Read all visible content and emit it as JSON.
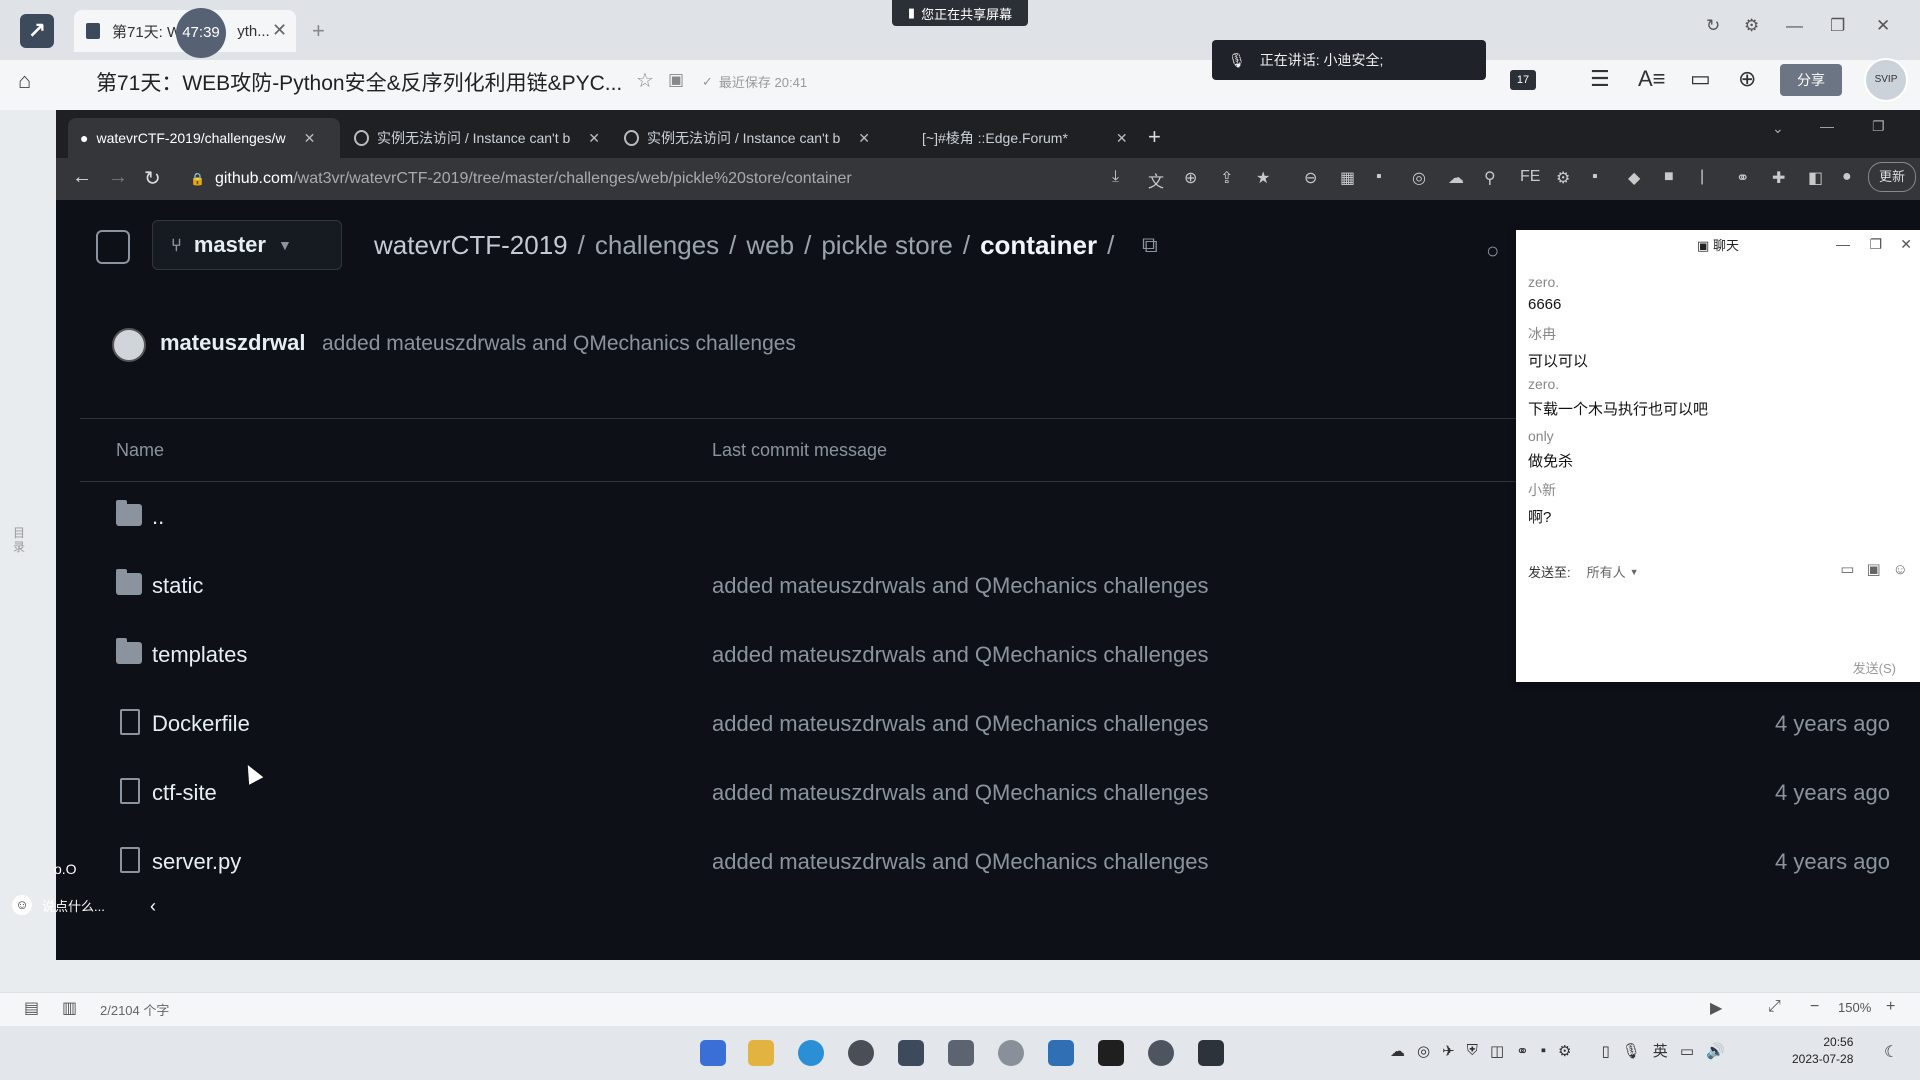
{
  "app": {
    "tab_title": "第71天: W",
    "tab_title_suffix": "yth...",
    "timer": "47:39",
    "sharing_banner": "您正在共享屏幕",
    "doc_title": "第71天：WEB攻防-Python安全&反序列化利用链&PYC...",
    "save_status": "最近保存 20:41",
    "speaking": "正在讲话: 小迪安全;",
    "count_badge": "17",
    "share_label": "分享",
    "avatar_label": "SVIP",
    "left_rail": "目录"
  },
  "browser": {
    "tabs": [
      {
        "label": "watevrCTF-2019/challenges/w"
      },
      {
        "label": "实例无法访问 / Instance can't b"
      },
      {
        "label": "实例无法访问 / Instance can't b"
      },
      {
        "label": "[~]#棱角 ::Edge.Forum*"
      }
    ],
    "url_host": "github.com",
    "url_path": "/wat3vr/watevrCTF-2019/tree/master/challenges/web/pickle%20store/container",
    "update_label": "更新"
  },
  "github": {
    "branch": "master",
    "breadcrumb": {
      "repo": "watevrCTF-2019",
      "parts": [
        "challenges",
        "web",
        "pickle store"
      ],
      "current": "container"
    },
    "commit": {
      "author": "mateuszdrwal",
      "message": "added mateuszdrwals and QMechanics challenges"
    },
    "table": {
      "col_name": "Name",
      "col_message": "Last commit message",
      "rows": [
        {
          "type": "folder",
          "name": "..",
          "message": "",
          "date": ""
        },
        {
          "type": "folder",
          "name": "static",
          "message": "added mateuszdrwals and QMechanics challenges",
          "date": ""
        },
        {
          "type": "folder",
          "name": "templates",
          "message": "added mateuszdrwals and QMechanics challenges",
          "date": ""
        },
        {
          "type": "file",
          "name": "Dockerfile",
          "message": "added mateuszdrwals and QMechanics challenges",
          "date": "4 years ago"
        },
        {
          "type": "file",
          "name": "ctf-site",
          "message": "added mateuszdrwals and QMechanics challenges",
          "date": "4 years ago"
        },
        {
          "type": "file",
          "name": "server.py",
          "message": "added mateuszdrwals and QMechanics challenges",
          "date": "4 years ago"
        }
      ]
    }
  },
  "comment": {
    "emoji_text": "o.O",
    "placeholder": "说点什么..."
  },
  "chat": {
    "title": "聊天",
    "messages": [
      {
        "sender": "zero.",
        "text": "6666"
      },
      {
        "sender": "冰冉",
        "text": "可以可以"
      },
      {
        "sender": "zero.",
        "text": "下载一个木马执行也可以吧"
      },
      {
        "sender": "only",
        "text": "做免杀"
      },
      {
        "sender": "小新",
        "text": "啊?"
      }
    ],
    "send_to_label": "发送至:",
    "send_to_target": "所有人",
    "send_button": "发送(S)"
  },
  "status": {
    "word_count": "2/2104 个字",
    "zoom": "150%"
  },
  "clock": {
    "time": "20:56",
    "date": "2023-07-28"
  },
  "tray": {
    "ime": "英"
  },
  "colors": {
    "github_bg": "#0d1117",
    "chat_bg": "#ffffff",
    "taskbar_bg": "#e3e6ea"
  }
}
